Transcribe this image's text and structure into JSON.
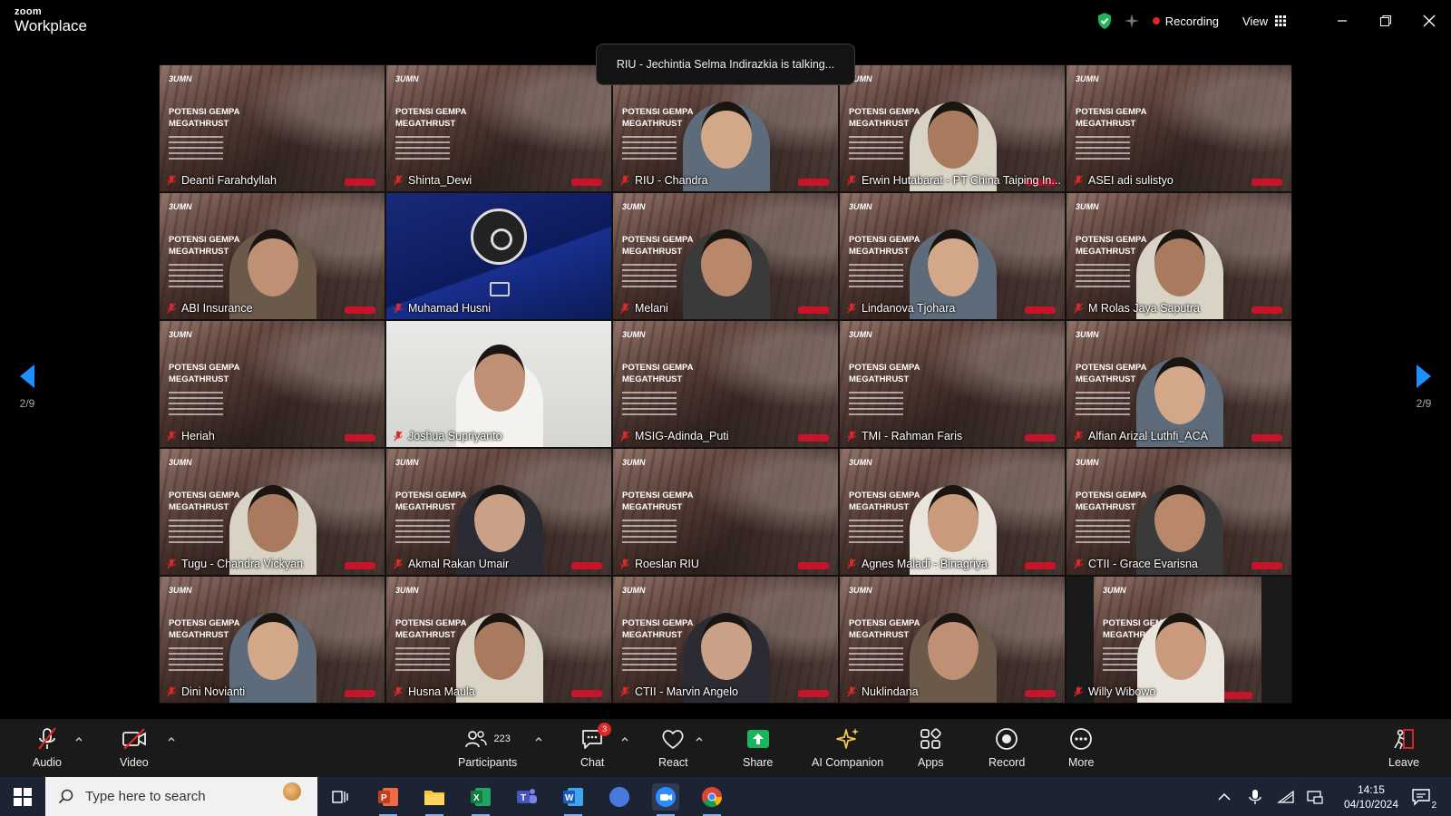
{
  "app": {
    "brand_small": "zoom",
    "brand_large": "Workplace",
    "recording_label": "Recording",
    "view_label": "View"
  },
  "toast": {
    "text": "RIU - Jechintia Selma Indirazkia is talking..."
  },
  "poster": {
    "brand": "3UMN",
    "title_line1": "POTENSI GEMPA",
    "title_line2": "MEGATHRUST"
  },
  "participants": [
    {
      "name": "Deanti Farahdyllah",
      "kind": "poster"
    },
    {
      "name": "Shinta_Dewi",
      "kind": "poster"
    },
    {
      "name": "RIU - Chandra",
      "kind": "person"
    },
    {
      "name": "Erwin Hutabarat - PT China Taiping In...",
      "kind": "person"
    },
    {
      "name": "ASEI adi sulistyo",
      "kind": "poster"
    },
    {
      "name": "ABI Insurance",
      "kind": "person"
    },
    {
      "name": "Muhamad Husni",
      "kind": "obs"
    },
    {
      "name": "Melani",
      "kind": "person"
    },
    {
      "name": "Lindanova Tjohara",
      "kind": "person"
    },
    {
      "name": "M Rolas Jaya Saputra",
      "kind": "person"
    },
    {
      "name": "Heriah",
      "kind": "poster"
    },
    {
      "name": "Joshua Supriyanto",
      "kind": "video"
    },
    {
      "name": "MSIG-Adinda_Puti",
      "kind": "poster"
    },
    {
      "name": "TMI - Rahman Faris",
      "kind": "poster"
    },
    {
      "name": "Alfian Arizal Luthfi_ACA",
      "kind": "person"
    },
    {
      "name": "Tugu - Chandra Vickyan",
      "kind": "person"
    },
    {
      "name": "Akmal Rakan Umair",
      "kind": "person"
    },
    {
      "name": "Roeslan RIU",
      "kind": "poster"
    },
    {
      "name": "Agnes Maladi - Binagriya",
      "kind": "person"
    },
    {
      "name": "CTII - Grace Evarisna",
      "kind": "person"
    },
    {
      "name": "Dini Novianti",
      "kind": "person"
    },
    {
      "name": "Husna Maula",
      "kind": "person"
    },
    {
      "name": "CTII - Marvin Angelo",
      "kind": "person"
    },
    {
      "name": "Nuklindana",
      "kind": "person"
    },
    {
      "name": "Willy Wibowo",
      "kind": "partial"
    }
  ],
  "pager": {
    "left": "2/9",
    "right": "2/9"
  },
  "toolbar": {
    "audio": "Audio",
    "video": "Video",
    "participants": "Participants",
    "participants_count": "223",
    "chat": "Chat",
    "chat_badge": "3",
    "react": "React",
    "share": "Share",
    "ai_companion": "AI Companion",
    "apps": "Apps",
    "record": "Record",
    "more": "More",
    "leave": "Leave"
  },
  "taskbar": {
    "search_placeholder": "Type here to search",
    "time": "14:15",
    "date": "04/10/2024",
    "notification_count": "2"
  },
  "colors": {
    "accent_blue": "#1e8fff",
    "recording_red": "#e02828",
    "share_green": "#19b45b",
    "ai_yellow": "#f2c94c"
  }
}
